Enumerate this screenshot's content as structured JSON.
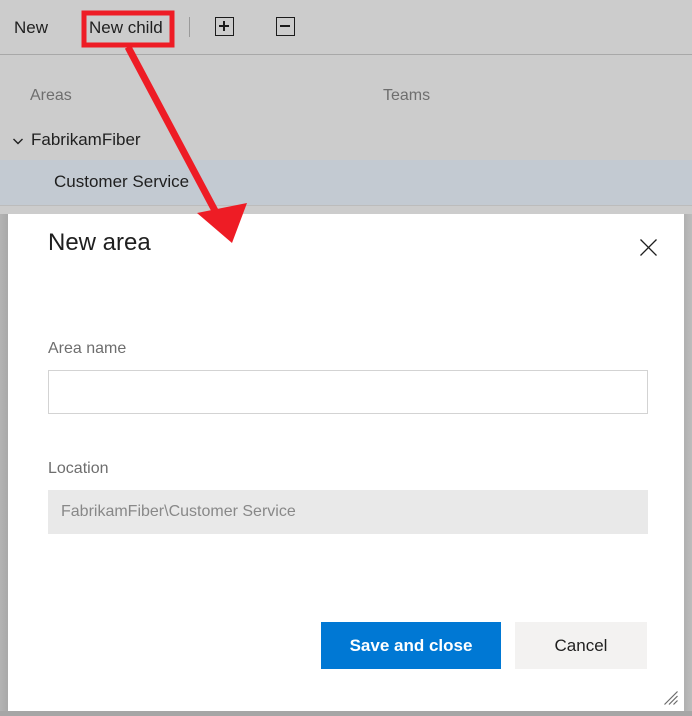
{
  "toolbar": {
    "new_label": "New",
    "new_child_label": "New child",
    "expand_icon": "plus-square-icon",
    "collapse_icon": "minus-square-icon",
    "separator": "|"
  },
  "columns": {
    "areas_header": "Areas",
    "teams_header": "Teams"
  },
  "tree": {
    "root": {
      "label": "FabrikamFiber",
      "expand_icon": "chevron-down-icon",
      "expanded": true
    },
    "selected_child": {
      "label": "Customer Service",
      "selected": true
    }
  },
  "dialog": {
    "title": "New area",
    "close_icon": "close-icon",
    "fields": [
      {
        "name": "area-name",
        "label": "Area name",
        "value": "",
        "placeholder": "",
        "readonly": false
      },
      {
        "name": "location",
        "label": "Location",
        "value": "FabrikamFiber\\Customer Service",
        "readonly": true
      }
    ],
    "buttons": {
      "save_label": "Save and close",
      "cancel_label": "Cancel"
    },
    "resize_grip_icon": "resize-grip-icon"
  },
  "annotation": {
    "highlight_target": "New child",
    "arrow_icon": "red-arrow-icon"
  },
  "colors": {
    "accent": "#0078d4",
    "annotation": "#ee1c25",
    "app_background": "#cccccc",
    "selected_row": "#c3cad2",
    "dialog_background": "#ffffff",
    "readonly_field": "#e9e9e9",
    "cancel_button": "#f3f2f1"
  }
}
